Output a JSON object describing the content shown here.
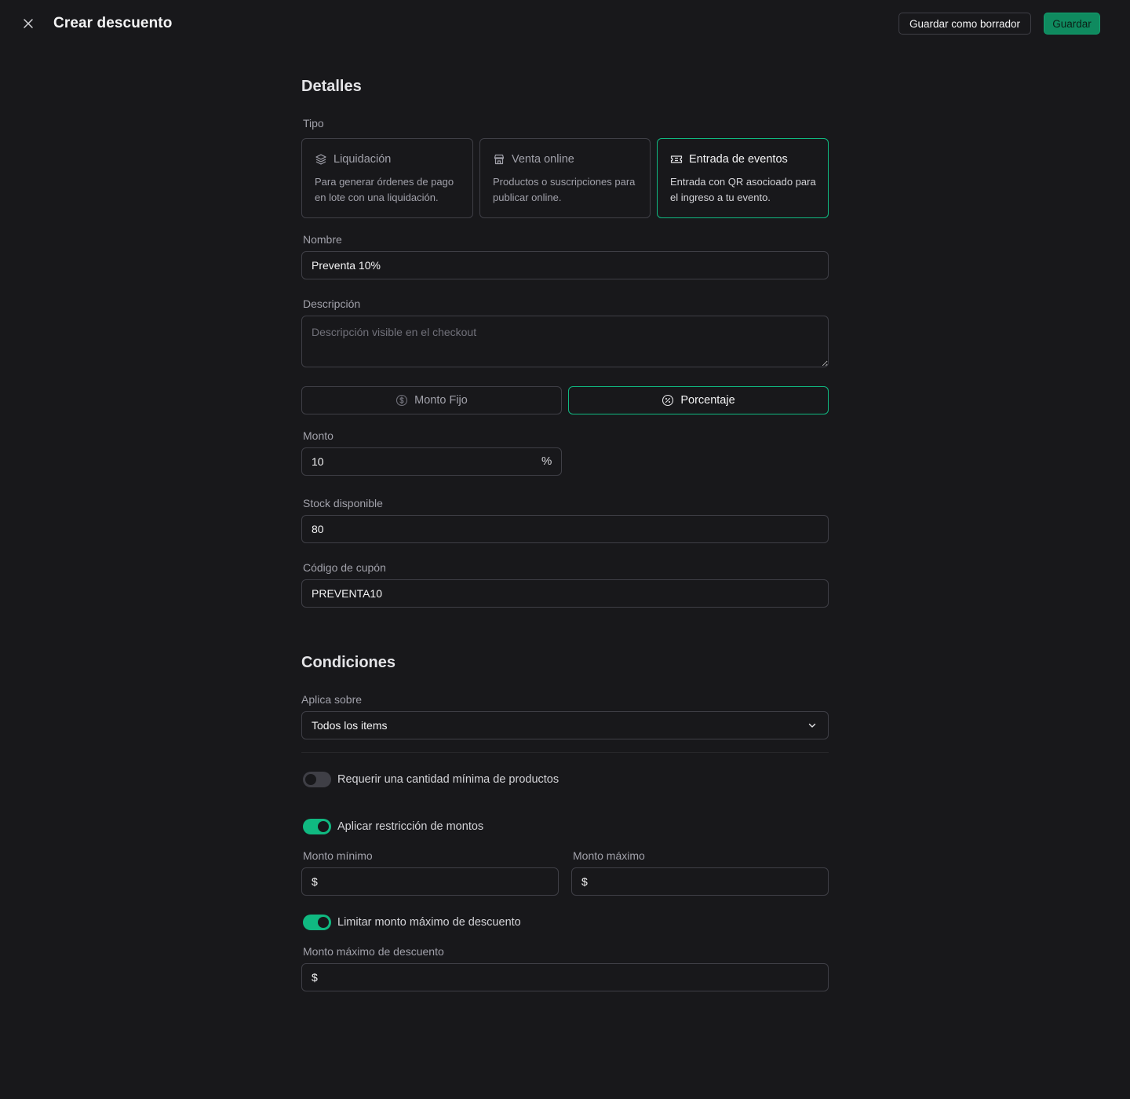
{
  "header": {
    "title": "Crear descuento",
    "draft_label": "Guardar como borrador",
    "save_label": "Guardar"
  },
  "details": {
    "title": "Detalles",
    "type_label": "Tipo",
    "types": [
      {
        "icon": "layers-icon",
        "title": "Liquidación",
        "description": "Para generar órdenes de pago en lote con una liquidación.",
        "selected": false
      },
      {
        "icon": "store-icon",
        "title": "Venta online",
        "description": "Productos o suscripciones para publicar online.",
        "selected": false
      },
      {
        "icon": "ticket-icon",
        "title": "Entrada de eventos",
        "description": "Entrada con QR asocioado para el ingreso a tu evento.",
        "selected": true
      }
    ],
    "name_label": "Nombre",
    "name_value": "Preventa 10%",
    "description_label": "Descripción",
    "description_placeholder": "Descripción visible en el checkout",
    "discount_mode": [
      {
        "icon": "dollar-circle-icon",
        "label": "Monto Fijo",
        "selected": false
      },
      {
        "icon": "percent-circle-icon",
        "label": "Porcentaje",
        "selected": true
      }
    ],
    "amount_label": "Monto",
    "amount_value": "10",
    "amount_suffix": "%",
    "stock_label": "Stock disponible",
    "stock_value": "80",
    "coupon_label": "Código de cupón",
    "coupon_value": "PREVENTA10"
  },
  "conditions": {
    "title": "Condiciones",
    "applies_label": "Aplica sobre",
    "applies_value": "Todos los items",
    "min_qty_toggle": {
      "label": "Requerir una cantidad mínima de productos",
      "on": false
    },
    "amount_restriction_toggle": {
      "label": "Aplicar restricción de montos",
      "on": true
    },
    "min_amount_label": "Monto mínimo",
    "max_amount_label": "Monto máximo",
    "currency_prefix": "$",
    "limit_discount_toggle": {
      "label": "Limitar monto máximo de descuento",
      "on": true
    },
    "max_discount_label": "Monto máximo de descuento"
  },
  "colors": {
    "background": "#18181b",
    "accent": "#10b981",
    "border": "#3f3f46"
  }
}
